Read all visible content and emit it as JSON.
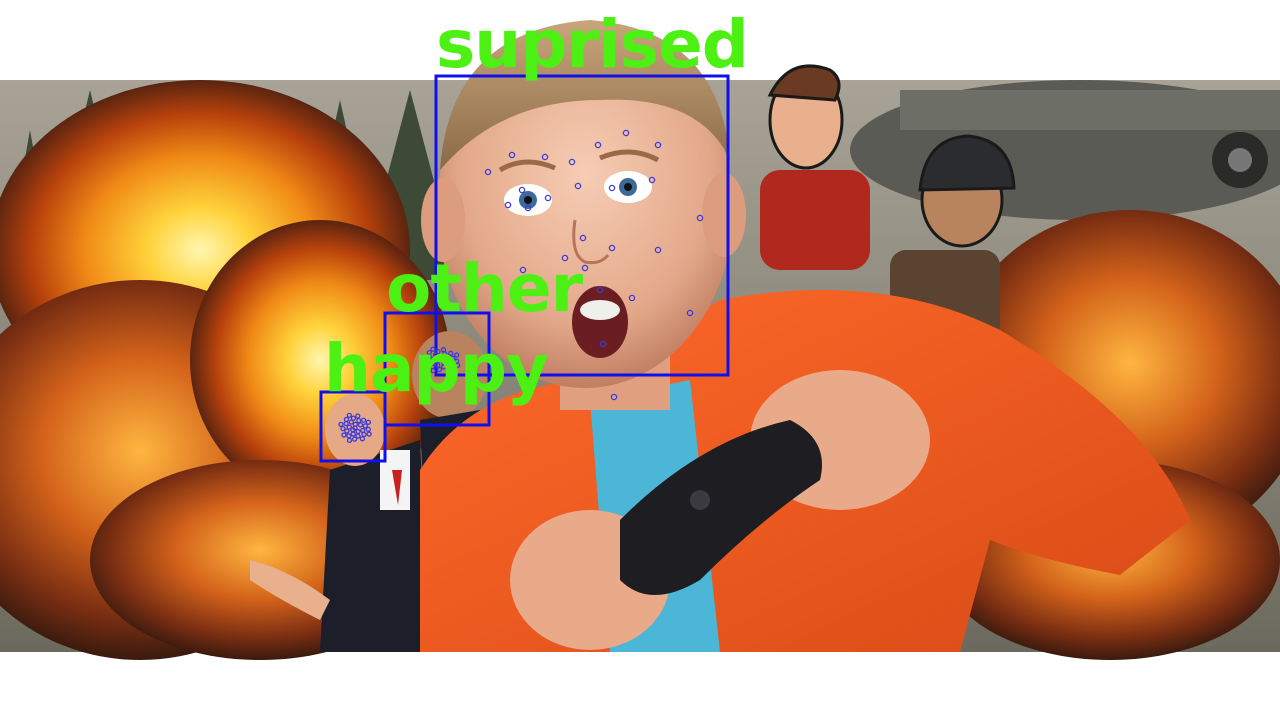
{
  "detections": [
    {
      "label": "suprised",
      "box_color": "#1010ee"
    },
    {
      "label": "other",
      "box_color": "#1010ee"
    },
    {
      "label": "happy",
      "box_color": "#1010ee"
    }
  ],
  "colors": {
    "label_text": "#4cf012",
    "box": "#1010ee",
    "landmark": "#3a3ae0",
    "background_band": "#ffffff"
  }
}
